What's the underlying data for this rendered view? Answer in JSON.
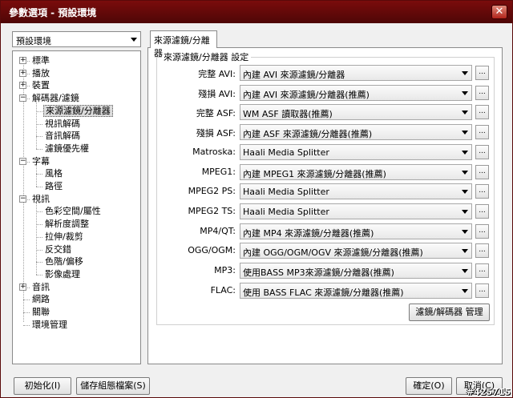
{
  "window": {
    "title": "參數選項 - 預設環境",
    "close_glyph": "✕"
  },
  "profile": {
    "selected": "預設環境"
  },
  "tree": [
    {
      "label": "標準",
      "expander": "+"
    },
    {
      "label": "播放",
      "expander": "+"
    },
    {
      "label": "裝置",
      "expander": "+"
    },
    {
      "label": "解碼器/濾鏡",
      "expander": "−"
    },
    {
      "label": "來源濾鏡/分離器"
    },
    {
      "label": "視訊解碼"
    },
    {
      "label": "音訊解碼"
    },
    {
      "label": "濾鏡優先權"
    },
    {
      "label": "字幕",
      "expander": "−"
    },
    {
      "label": "風格"
    },
    {
      "label": "路徑"
    },
    {
      "label": "視訊",
      "expander": "−"
    },
    {
      "label": "色彩空間/屬性"
    },
    {
      "label": "解析度調整"
    },
    {
      "label": "拉伸/裁剪"
    },
    {
      "label": "反交錯"
    },
    {
      "label": "色階/偏移"
    },
    {
      "label": "影像處理"
    },
    {
      "label": "音訊",
      "expander": "+"
    },
    {
      "label": "網路"
    },
    {
      "label": "關聯"
    },
    {
      "label": "環境管理"
    }
  ],
  "tab": {
    "label": "來源濾鏡/分離器"
  },
  "group": {
    "title": "來源濾鏡/分離器 設定"
  },
  "fields": [
    {
      "label": "完整 AVI:",
      "value": "內建 AVI 來源濾鏡/分離器"
    },
    {
      "label": "殘損 AVI:",
      "value": "內建 AVI 來源濾鏡/分離器(推薦)"
    },
    {
      "label": "完整 ASF:",
      "value": "WM ASF 讀取器(推薦)"
    },
    {
      "label": "殘損 ASF:",
      "value": "內建 ASF 來源濾鏡/分離器(推薦)"
    },
    {
      "label": "Matroska:",
      "value": "Haali Media Splitter"
    },
    {
      "label": "MPEG1:",
      "value": "內建 MPEG1 來源濾鏡/分離器(推薦)"
    },
    {
      "label": "MPEG2 PS:",
      "value": "Haali Media Splitter"
    },
    {
      "label": "MPEG2 TS:",
      "value": "Haali Media Splitter"
    },
    {
      "label": "MP4/QT:",
      "value": "內建 MP4 來源濾鏡/分離器(推薦)"
    },
    {
      "label": "OGG/OGM:",
      "value": "內建 OGG/OGM/OGV 來源濾鏡/分離器(推薦)"
    },
    {
      "label": "MP3:",
      "value": "使用BASS MP3來源濾鏡/分離器(推薦)"
    },
    {
      "label": "FLAC:",
      "value": "使用 BASS FLAC 來源濾鏡/分離器(推薦)"
    }
  ],
  "dots_label": "...",
  "filter_manager_label": "濾鏡/解碼器 管理",
  "buttons": {
    "init": "初始化(I)",
    "save_profile": "儲存組態檔案(S)",
    "ok": "確定(O)",
    "cancel": "取消(C)"
  },
  "watermark": "#425715"
}
